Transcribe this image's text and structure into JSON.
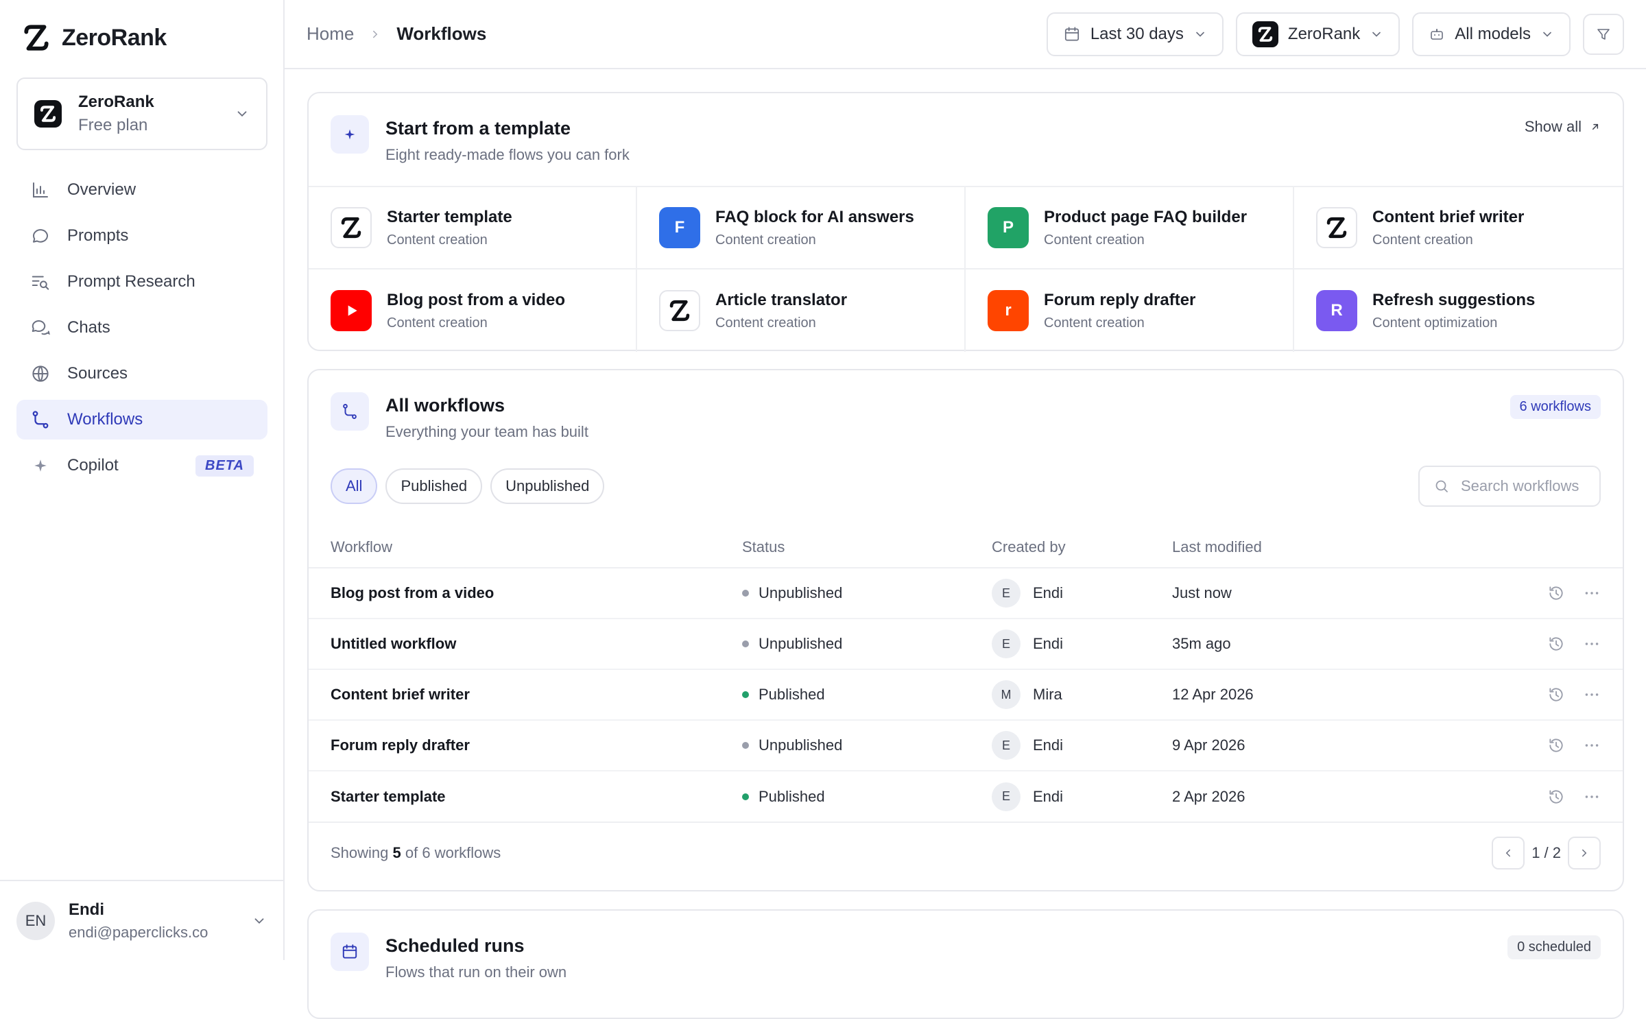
{
  "brand": {
    "name": "ZeroRank"
  },
  "org": {
    "name": "ZeroRank",
    "plan": "Free plan"
  },
  "nav": [
    {
      "label": "Overview",
      "icon": "bar-chart-icon",
      "active": false
    },
    {
      "label": "Prompts",
      "icon": "chat-bubble-icon",
      "active": false
    },
    {
      "label": "Prompt Research",
      "icon": "list-search-icon",
      "active": false
    },
    {
      "label": "Chats",
      "icon": "chats-icon",
      "active": false
    },
    {
      "label": "Sources",
      "icon": "globe-icon",
      "active": false
    },
    {
      "label": "Workflows",
      "icon": "route-icon",
      "active": true
    },
    {
      "label": "Copilot",
      "icon": "sparkle-icon",
      "active": false,
      "badge": "BETA"
    }
  ],
  "user": {
    "initials": "EN",
    "name": "Endi",
    "email": "endi@paperclicks.co"
  },
  "breadcrumb": {
    "home": "Home",
    "current": "Workflows"
  },
  "topbar": {
    "date_range": "Last 30 days",
    "org": "ZeroRank",
    "models": "All models"
  },
  "templates": {
    "title": "Start from a template",
    "subtitle": "Eight ready-made flows you can fork",
    "show_all": "Show all",
    "items": [
      {
        "name": "Starter template",
        "category": "Content creation",
        "icon": "zerorank-logo",
        "letter": ""
      },
      {
        "name": "FAQ block for AI answers",
        "category": "Content creation",
        "icon": "letter",
        "letter": "F",
        "color": "#2f6fe8"
      },
      {
        "name": "Product page FAQ builder",
        "category": "Content creation",
        "icon": "letter",
        "letter": "P",
        "color": "#21a366"
      },
      {
        "name": "Content brief writer",
        "category": "Content creation",
        "icon": "zerorank-logo",
        "letter": ""
      },
      {
        "name": "Blog post from a video",
        "category": "Content creation",
        "icon": "youtube-icon",
        "letter": "",
        "color": "#ff0000"
      },
      {
        "name": "Article translator",
        "category": "Content creation",
        "icon": "zerorank-logo",
        "letter": ""
      },
      {
        "name": "Forum reply drafter",
        "category": "Content creation",
        "icon": "letter",
        "letter": "r",
        "color": "#ff4500"
      },
      {
        "name": "Refresh suggestions",
        "category": "Content optimization",
        "icon": "letter",
        "letter": "R",
        "color": "#7a5af0"
      }
    ]
  },
  "workflows": {
    "title": "All workflows",
    "subtitle": "Everything your team has built",
    "count_badge": "6 workflows",
    "filters": [
      "All",
      "Published",
      "Unpublished"
    ],
    "active_filter": "All",
    "search_placeholder": "Search workflows",
    "columns": [
      "Workflow",
      "Status",
      "Created by",
      "Last modified"
    ],
    "rows": [
      {
        "name": "Blog post from a video",
        "status": "Unpublished",
        "initial": "E",
        "by": "Endi",
        "modified": "Just now"
      },
      {
        "name": "Untitled workflow",
        "status": "Unpublished",
        "initial": "E",
        "by": "Endi",
        "modified": "35m ago"
      },
      {
        "name": "Content brief writer",
        "status": "Published",
        "initial": "M",
        "by": "Mira",
        "modified": "12 Apr 2026"
      },
      {
        "name": "Forum reply drafter",
        "status": "Unpublished",
        "initial": "E",
        "by": "Endi",
        "modified": "9 Apr 2026"
      },
      {
        "name": "Starter template",
        "status": "Published",
        "initial": "E",
        "by": "Endi",
        "modified": "2 Apr 2026"
      }
    ],
    "footer": {
      "prefix": "Showing",
      "shown": "5",
      "suffix": "of 6 workflows"
    },
    "pager": "1 / 2",
    "status_colors": {
      "Published": "#22a06b",
      "Unpublished": "#9a9eab"
    }
  },
  "scheduled": {
    "title": "Scheduled runs",
    "subtitle": "Flows that run on their own",
    "count_badge": "0 scheduled"
  }
}
